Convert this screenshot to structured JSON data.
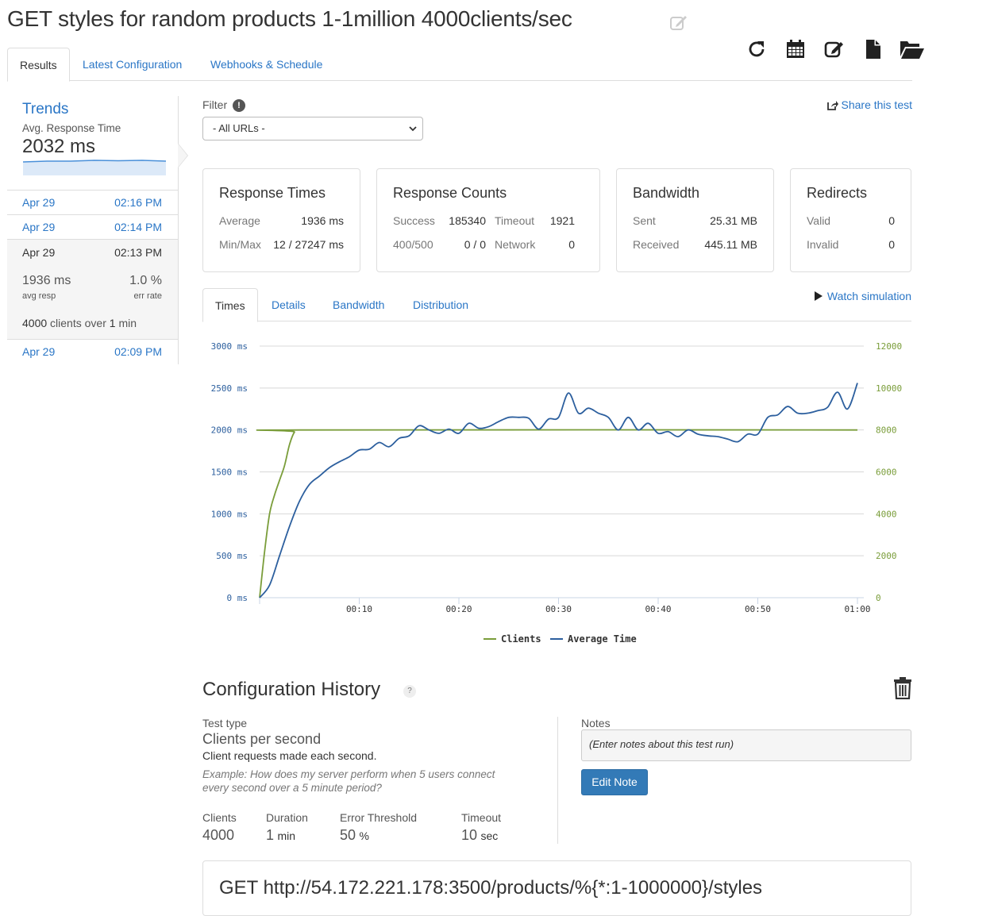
{
  "page": {
    "title": "GET styles for random products 1-1million 4000clients/sec"
  },
  "toolbar": {
    "icons": [
      "refresh-icon",
      "calendar-icon",
      "edit-icon",
      "file-icon",
      "folder-open-icon"
    ]
  },
  "tabs": [
    {
      "label": "Results",
      "active": true
    },
    {
      "label": "Latest Configuration",
      "active": false
    },
    {
      "label": "Webhooks & Schedule",
      "active": false
    }
  ],
  "sidebar": {
    "trends_title": "Trends",
    "trends_subtitle": "Avg. Response Time",
    "trends_value": "2032 ms",
    "runs": [
      {
        "date": "Apr 29",
        "time": "02:16 PM"
      },
      {
        "date": "Apr 29",
        "time": "02:14 PM"
      },
      {
        "date": "Apr 29",
        "time": "02:13 PM",
        "active": true,
        "avg_resp": "1936 ms",
        "avg_resp_label": "avg resp",
        "err_rate": "1.0 %",
        "err_rate_label": "err rate",
        "clients": "4000",
        "clients_over": "clients over",
        "duration": "1",
        "duration_unit": "min"
      },
      {
        "date": "Apr 29",
        "time": "02:09 PM"
      }
    ]
  },
  "filter": {
    "label": "Filter",
    "info": "!",
    "selected": "- All URLs -"
  },
  "share": {
    "label": "Share this test"
  },
  "panels": {
    "response_times": {
      "title": "Response Times",
      "average_label": "Average",
      "average": "1936 ms",
      "minmax_label": "Min/Max",
      "minmax": "12 / 27247 ms"
    },
    "response_counts": {
      "title": "Response Counts",
      "success_label": "Success",
      "success": "185340",
      "timeout_label": "Timeout",
      "timeout": "1921",
      "errors_label": "400/500",
      "errors": "0 / 0",
      "network_label": "Network",
      "network": "0"
    },
    "bandwidth": {
      "title": "Bandwidth",
      "sent_label": "Sent",
      "sent": "25.31 MB",
      "received_label": "Received",
      "received": "445.11 MB"
    },
    "redirects": {
      "title": "Redirects",
      "valid_label": "Valid",
      "valid": "0",
      "invalid_label": "Invalid",
      "invalid": "0"
    }
  },
  "subtabs": [
    {
      "label": "Times",
      "active": true
    },
    {
      "label": "Details",
      "active": false
    },
    {
      "label": "Bandwidth",
      "active": false
    },
    {
      "label": "Distribution",
      "active": false
    }
  ],
  "watch": {
    "label": "Watch simulation"
  },
  "chart_data": {
    "type": "line",
    "y_left_ticks": [
      "0 ms",
      "500 ms",
      "1000 ms",
      "1500 ms",
      "2000 ms",
      "2500 ms",
      "3000 ms"
    ],
    "y_right_ticks": [
      "0",
      "2000",
      "4000",
      "6000",
      "8000",
      "10000",
      "12000"
    ],
    "x_ticks": [
      "00:10",
      "00:20",
      "00:30",
      "00:40",
      "00:50",
      "01:00"
    ],
    "ylim_left": [
      0,
      3000
    ],
    "ylim_right": [
      0,
      12000
    ],
    "xlim": [
      0,
      60
    ],
    "grid": true,
    "legend_position": "bottom",
    "colors": {
      "clients": "#7a9d3a",
      "average_time": "#2c5f9e",
      "left_axis": "#2c5f9e",
      "right_axis": "#7a9d3a"
    },
    "series": [
      {
        "name": "Clients",
        "axis": "right",
        "points": [
          [
            0,
            0
          ],
          [
            0.5,
            2200
          ],
          [
            1,
            4000
          ],
          [
            1.5,
            4900
          ],
          [
            2,
            5600
          ],
          [
            2.5,
            6300
          ],
          [
            3,
            7300
          ],
          [
            3.5,
            7900
          ],
          [
            4,
            8000
          ],
          [
            60,
            8000
          ]
        ]
      },
      {
        "name": "Average Time",
        "axis": "left",
        "points": [
          [
            0,
            0
          ],
          [
            1,
            150
          ],
          [
            2,
            500
          ],
          [
            3,
            850
          ],
          [
            4,
            1150
          ],
          [
            5,
            1350
          ],
          [
            6,
            1450
          ],
          [
            7,
            1550
          ],
          [
            8,
            1620
          ],
          [
            9,
            1680
          ],
          [
            10,
            1760
          ],
          [
            11,
            1770
          ],
          [
            12,
            1850
          ],
          [
            13,
            1800
          ],
          [
            14,
            1900
          ],
          [
            15,
            1930
          ],
          [
            16,
            2050
          ],
          [
            17,
            2000
          ],
          [
            18,
            1960
          ],
          [
            19,
            2010
          ],
          [
            20,
            1960
          ],
          [
            21,
            2080
          ],
          [
            22,
            2020
          ],
          [
            23,
            2040
          ],
          [
            24,
            2100
          ],
          [
            25,
            2150
          ],
          [
            26,
            2150
          ],
          [
            27,
            2140
          ],
          [
            28,
            2010
          ],
          [
            29,
            2130
          ],
          [
            30,
            2150
          ],
          [
            31,
            2440
          ],
          [
            32,
            2200
          ],
          [
            33,
            2260
          ],
          [
            34,
            2200
          ],
          [
            35,
            2150
          ],
          [
            36,
            2000
          ],
          [
            37,
            2150
          ],
          [
            38,
            2000
          ],
          [
            39,
            2080
          ],
          [
            40,
            1960
          ],
          [
            41,
            1980
          ],
          [
            42,
            1920
          ],
          [
            43,
            2000
          ],
          [
            44,
            1950
          ],
          [
            45,
            1930
          ],
          [
            46,
            1920
          ],
          [
            47,
            1890
          ],
          [
            48,
            1860
          ],
          [
            49,
            1950
          ],
          [
            50,
            1950
          ],
          [
            51,
            2150
          ],
          [
            52,
            2180
          ],
          [
            53,
            2280
          ],
          [
            54,
            2200
          ],
          [
            55,
            2200
          ],
          [
            56,
            2230
          ],
          [
            57,
            2270
          ],
          [
            58,
            2450
          ],
          [
            59,
            2250
          ],
          [
            60,
            2560
          ]
        ]
      }
    ]
  },
  "config": {
    "title": "Configuration History",
    "help": "?",
    "test_type_label": "Test type",
    "test_type": "Clients per second",
    "test_type_desc": "Client requests made each second.",
    "example": "Example: How does my server perform when 5 users connect every second over a 5 minute period?",
    "clients_label": "Clients",
    "clients": "4000",
    "duration_label": "Duration",
    "duration": "1",
    "duration_unit": "min",
    "error_threshold_label": "Error Threshold",
    "error_threshold": "50",
    "error_threshold_unit": "%",
    "timeout_label": "Timeout",
    "timeout": "10",
    "timeout_unit": "sec",
    "notes_label": "Notes",
    "notes_placeholder": "(Enter notes about this test run)",
    "edit_note": "Edit Note"
  },
  "request": {
    "line": "GET http://54.172.221.178:3500/products/%{*:1-1000000}/styles"
  }
}
